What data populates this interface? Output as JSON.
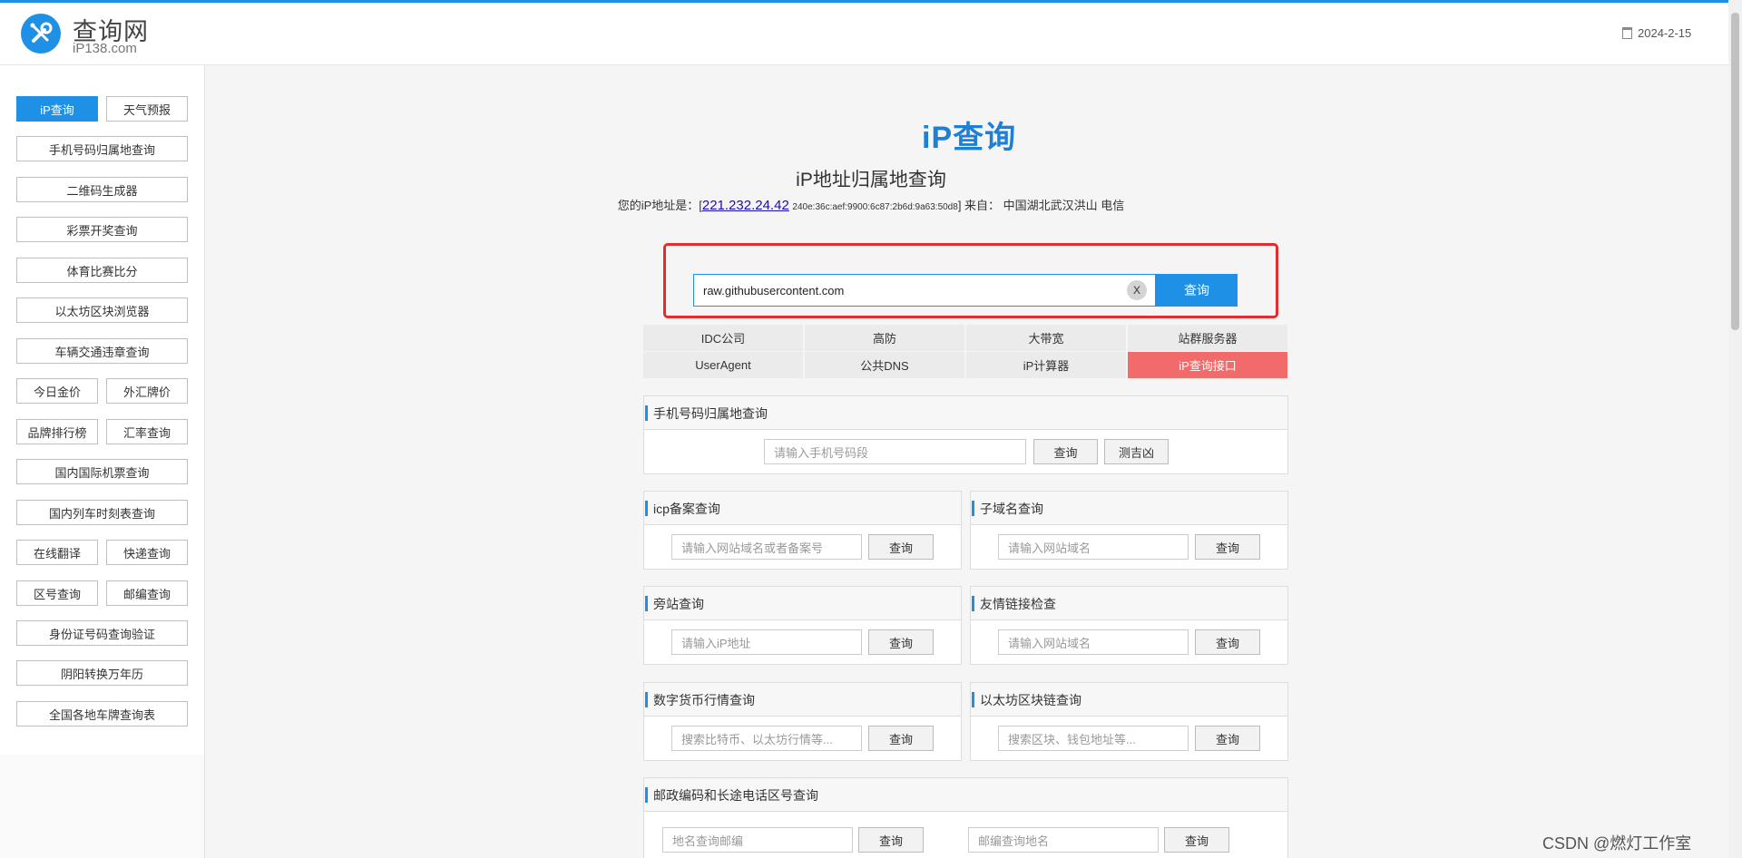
{
  "header": {
    "site_name": "查询网",
    "site_domain": "iP138.com",
    "date": "2024-2-15"
  },
  "sidebar": {
    "items": [
      {
        "label": "iP查询",
        "active": true
      },
      {
        "label": "天气预报"
      },
      {
        "label": "手机号码归属地查询"
      },
      {
        "label": "二维码生成器"
      },
      {
        "label": "彩票开奖查询"
      },
      {
        "label": "体育比赛比分"
      },
      {
        "label": "以太坊区块浏览器"
      },
      {
        "label": "车辆交通违章查询"
      },
      {
        "label": "今日金价"
      },
      {
        "label": "外汇牌价"
      },
      {
        "label": "品牌排行榜"
      },
      {
        "label": "汇率查询"
      },
      {
        "label": "国内国际机票查询"
      },
      {
        "label": "国内列车时刻表查询"
      },
      {
        "label": "在线翻译"
      },
      {
        "label": "快递查询"
      },
      {
        "label": "区号查询"
      },
      {
        "label": "邮编查询"
      },
      {
        "label": "身份证号码查询验证"
      },
      {
        "label": "阴阳转换万年历"
      },
      {
        "label": "全国各地车牌查询表"
      }
    ]
  },
  "main": {
    "logo_text": "iP查询",
    "title": "iP地址归属地查询",
    "myip": {
      "prefix": "您的iP地址是：[",
      "ipv4": "221.232.24.42",
      "ipv6": "240e:36c:aef:9900:6c87:2b6d:9a63:50d8",
      "suffix": "] 来自：",
      "location": "中国湖北武汉洪山 电信"
    },
    "search": {
      "value": "raw.githubusercontent.com",
      "clear_label": "X",
      "button_label": "查询"
    },
    "quick_links": [
      {
        "label": "IDC公司"
      },
      {
        "label": "高防"
      },
      {
        "label": "大带宽"
      },
      {
        "label": "站群服务器"
      },
      {
        "label": "UserAgent"
      },
      {
        "label": "公共DNS"
      },
      {
        "label": "iP计算器"
      },
      {
        "label": "iP查询接口",
        "highlight_color": "#f26a6a"
      }
    ],
    "panels": {
      "phone": {
        "title": "手机号码归属地查询",
        "placeholder": "请输入手机号码段",
        "btn1": "查询",
        "btn2": "测吉凶"
      },
      "icp": {
        "title": "icp备案查询",
        "placeholder": "请输入网站域名或者备案号",
        "btn": "查询"
      },
      "subdomain": {
        "title": "子域名查询",
        "placeholder": "请输入网站域名",
        "btn": "查询"
      },
      "sidesite": {
        "title": "旁站查询",
        "placeholder": "请输入iP地址",
        "btn": "查询"
      },
      "friendlink": {
        "title": "友情链接检查",
        "placeholder": "请输入网站域名",
        "btn": "查询"
      },
      "crypto": {
        "title": "数字货币行情查询",
        "placeholder": "搜索比特币、以太坊行情等...",
        "btn": "查询"
      },
      "eth": {
        "title": "以太坊区块链查询",
        "placeholder": "搜索区块、钱包地址等...",
        "btn": "查询"
      },
      "postcode": {
        "title": "邮政编码和长途电话区号查询",
        "placeholder1": "地名查询邮编",
        "btn1": "查询",
        "placeholder2": "邮编查询地名",
        "btn2": "查询"
      }
    }
  },
  "watermark": "CSDN @燃灯工作室",
  "colors": {
    "accent": "#1e90e6",
    "highlight": "#e52b2b",
    "hot": "#f26a6a"
  }
}
